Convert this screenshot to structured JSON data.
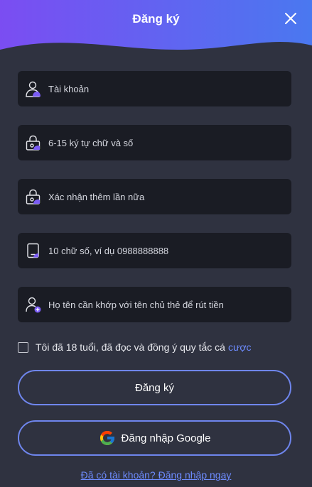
{
  "header": {
    "title": "Đăng ký"
  },
  "form": {
    "username_placeholder": "Tài khoản",
    "password_placeholder": "6-15 ký tự chữ và số",
    "confirm_placeholder": "Xác nhận thêm lần nữa",
    "phone_placeholder": "10 chữ số, ví dụ 0988888888",
    "fullname_placeholder": "Họ tên cần khớp với tên chủ thẻ để rút tiền"
  },
  "agreement": {
    "text": "Tôi đã 18 tuổi, đã đọc và đồng ý quy tắc cá",
    "link": "cược"
  },
  "buttons": {
    "register": "Đăng ký",
    "google": "Đăng nhập Google"
  },
  "footer": {
    "login_link": "Đã có tài khoản? Đăng nhập ngay"
  },
  "colors": {
    "background": "#2f3240",
    "field": "#1a1c24",
    "accent": "#6f86ee",
    "link": "#6e8cff",
    "header_gradient_start": "#7b4df2",
    "header_gradient_end": "#4a78f0"
  },
  "icons": {
    "close": "close-icon",
    "user": "user-icon",
    "lock": "lock-icon",
    "lock_confirm": "lock-icon",
    "phone": "phone-icon",
    "user_add": "user-add-icon",
    "google": "google-icon"
  }
}
